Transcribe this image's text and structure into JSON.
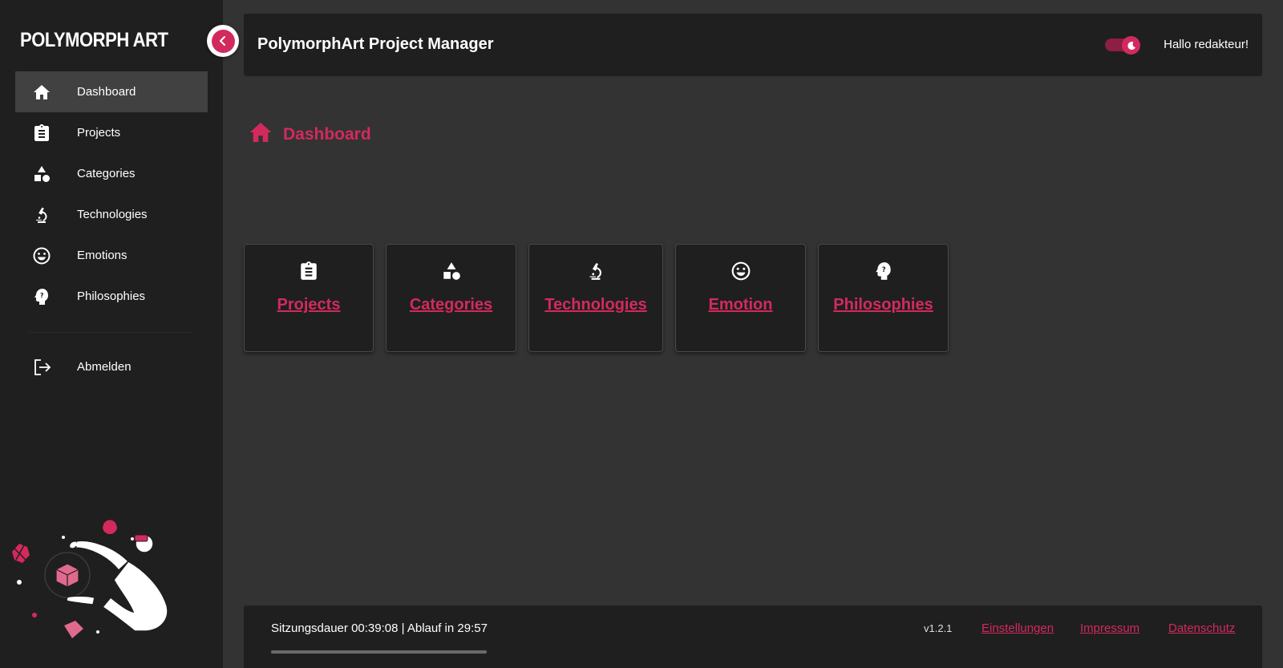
{
  "sidebar": {
    "logo": "POLYMORPH ART",
    "items": [
      {
        "label": "Dashboard",
        "icon": "home-icon",
        "active": true
      },
      {
        "label": "Projects",
        "icon": "clipboard-icon"
      },
      {
        "label": "Categories",
        "icon": "shapes-icon"
      },
      {
        "label": "Technologies",
        "icon": "microscope-icon"
      },
      {
        "label": "Emotions",
        "icon": "smiley-icon"
      },
      {
        "label": "Philosophies",
        "icon": "thinking-head-icon"
      }
    ],
    "logout_label": "Abmelden"
  },
  "header": {
    "title": "PolymorphArt Project Manager",
    "greeting": "Hallo redakteur!"
  },
  "page": {
    "heading": "Dashboard"
  },
  "cards": [
    {
      "label": "Projects",
      "icon": "clipboard-icon"
    },
    {
      "label": "Categories",
      "icon": "shapes-icon"
    },
    {
      "label": "Technologies",
      "icon": "microscope-icon"
    },
    {
      "label": "Emotion",
      "icon": "smiley-icon"
    },
    {
      "label": "Philosophies",
      "icon": "thinking-head-icon"
    }
  ],
  "footer": {
    "session": "Sitzungsdauer 00:39:08 | Ablauf in 29:57",
    "version": "v1.2.1",
    "links": {
      "settings": "Einstellungen",
      "imprint": "Impressum",
      "privacy": "Datenschutz"
    }
  },
  "colors": {
    "accent": "#d32a5e",
    "sidebar_bg": "#1f1f1f",
    "main_bg": "#333333",
    "active_item_bg": "#414141"
  }
}
